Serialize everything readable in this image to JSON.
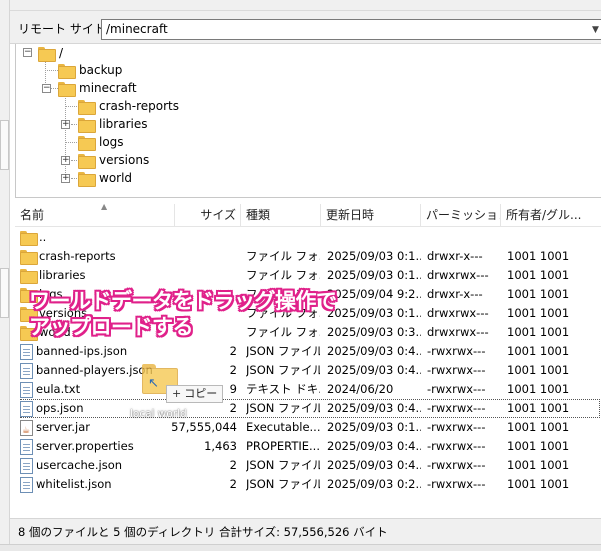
{
  "remote_site": {
    "label": "リモート サイト:",
    "path": "/minecraft"
  },
  "tree": {
    "root": "/",
    "nodes": [
      {
        "label": "backup"
      },
      {
        "label": "minecraft"
      },
      {
        "label": "crash-reports"
      },
      {
        "label": "libraries"
      },
      {
        "label": "logs"
      },
      {
        "label": "versions"
      },
      {
        "label": "world"
      }
    ]
  },
  "columns": {
    "name": "名前",
    "size": "サイズ",
    "type": "種類",
    "modified": "更新日時",
    "permissions": "パーミッション",
    "owner": "所有者/グル..."
  },
  "files": [
    {
      "name": "..",
      "size": "",
      "type": "",
      "modified": "",
      "perms": "",
      "owner": "",
      "icon": "folder-icon"
    },
    {
      "name": "crash-reports",
      "size": "",
      "type": "ファイル フォ...",
      "modified": "2025/09/03 0:1...",
      "perms": "drwxr-x---",
      "owner": "1001 1001",
      "icon": "folder-icon"
    },
    {
      "name": "libraries",
      "size": "",
      "type": "ファイル フォ...",
      "modified": "2025/09/03 0:1...",
      "perms": "drwxrwx---",
      "owner": "1001 1001",
      "icon": "folder-icon"
    },
    {
      "name": "logs",
      "size": "",
      "type": "ファイル フォ...",
      "modified": "2025/09/04 9:2...",
      "perms": "drwxr-x---",
      "owner": "1001 1001",
      "icon": "folder-icon"
    },
    {
      "name": "versions",
      "size": "",
      "type": "ファイル フォ...",
      "modified": "2025/09/03 0:1...",
      "perms": "drwxrwx---",
      "owner": "1001 1001",
      "icon": "folder-icon"
    },
    {
      "name": "world",
      "size": "",
      "type": "ファイル フォ...",
      "modified": "2025/09/03 0:3...",
      "perms": "drwxrwx---",
      "owner": "1001 1001",
      "icon": "folder-icon"
    },
    {
      "name": "banned-ips.json",
      "size": "2",
      "type": "JSON ファイル",
      "modified": "2025/09/03 0:4...",
      "perms": "-rwxrwx---",
      "owner": "1001 1001",
      "icon": "file-icon"
    },
    {
      "name": "banned-players.json",
      "size": "2",
      "type": "JSON ファイル",
      "modified": "2025/09/03 0:4...",
      "perms": "-rwxrwx---",
      "owner": "1001 1001",
      "icon": "file-icon"
    },
    {
      "name": "eula.txt",
      "size": "9",
      "type": "テキスト ドキ...",
      "modified": "2024/06/20",
      "perms": "-rwxrwx---",
      "owner": "1001 1001",
      "icon": "file-icon"
    },
    {
      "name": "ops.json",
      "size": "2",
      "type": "JSON ファイル",
      "modified": "2025/09/03 0:4...",
      "perms": "-rwxrwx---",
      "owner": "1001 1001",
      "icon": "file-icon",
      "focused": true
    },
    {
      "name": "server.jar",
      "size": "57,555,044",
      "type": "Executable...",
      "modified": "2025/09/03 0:1...",
      "perms": "-rwxrwx---",
      "owner": "1001 1001",
      "icon": "jar-icon"
    },
    {
      "name": "server.properties",
      "size": "1,463",
      "type": "PROPERTIE...",
      "modified": "2025/09/03 0:4...",
      "perms": "-rwxrwx---",
      "owner": "1001 1001",
      "icon": "file-icon"
    },
    {
      "name": "usercache.json",
      "size": "2",
      "type": "JSON ファイル",
      "modified": "2025/09/03 0:4...",
      "perms": "-rwxrwx---",
      "owner": "1001 1001",
      "icon": "file-icon"
    },
    {
      "name": "whitelist.json",
      "size": "2",
      "type": "JSON ファイル",
      "modified": "2025/09/03 0:2...",
      "perms": "-rwxrwx---",
      "owner": "1001 1001",
      "icon": "file-icon"
    }
  ],
  "status": "8 個のファイルと 5 個のディレクトリ 合計サイズ: 57,556,526 バイト",
  "annotation": {
    "line1": "ワールドデータをドラッグ操作で",
    "line2": "アップロードする",
    "color": "#e0218a"
  },
  "drag": {
    "tooltip": "コピー",
    "caption": "local world"
  }
}
